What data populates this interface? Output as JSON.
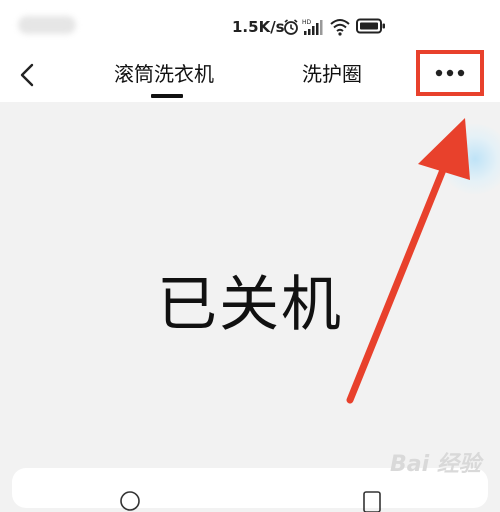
{
  "statusbar": {
    "net_speed": "1.5K/s",
    "icons": [
      "alarm-icon",
      "hd-icon",
      "signal-icon",
      "wifi-icon",
      "battery-icon"
    ]
  },
  "header": {
    "back_icon": "chevron-left-icon",
    "tabs": [
      {
        "label": "滚筒洗衣机",
        "active": true
      },
      {
        "label": "洗护圈",
        "active": false
      }
    ],
    "more_icon": "more-dots-icon",
    "highlight_color": "#e8412c"
  },
  "main": {
    "status_text": "已关机"
  },
  "watermark": {
    "text": "Bai 经验"
  }
}
